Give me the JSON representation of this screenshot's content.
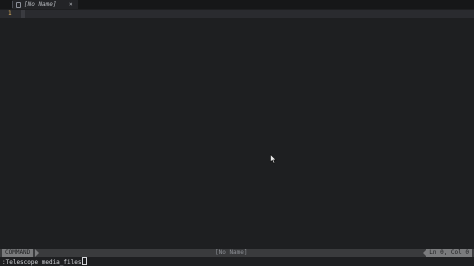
{
  "tabline": {
    "tab_label": "[No Name]",
    "close_glyph": "×",
    "tab_icon": "file-icon"
  },
  "editor": {
    "line_number": "1"
  },
  "statusline": {
    "mode": "COMMAND",
    "filename": "[No Name]",
    "position": "Ln 0, Col 0"
  },
  "cmdline": {
    "text": ":Telescope media_files"
  },
  "colors": {
    "background": "#1e1f21",
    "line_number": "#e0b15e",
    "statusline": "#3a3b3d"
  }
}
